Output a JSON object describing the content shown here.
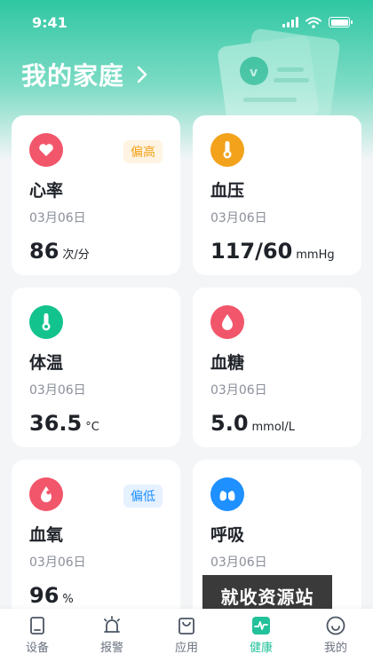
{
  "status_bar": {
    "time": "9:41"
  },
  "header": {
    "title": "我的家庭"
  },
  "colors": {
    "accent": "#23c19a",
    "red": "#f2566b",
    "orange": "#f3a21b",
    "green": "#13c38e",
    "blue": "#1e90ff"
  },
  "cards": [
    {
      "name": "心率",
      "date": "03月06日",
      "value": "86",
      "unit": "次/分",
      "badge": "偏高",
      "icon": "heart-icon",
      "icon_color": "#f2566b"
    },
    {
      "name": "血压",
      "date": "03月06日",
      "value": "117/60",
      "unit": "mmHg",
      "badge": "",
      "icon": "thermometer-icon",
      "icon_color": "#f3a21b"
    },
    {
      "name": "体温",
      "date": "03月06日",
      "value": "36.5",
      "unit": "°C",
      "badge": "",
      "icon": "thermometer-icon",
      "icon_color": "#13c38e"
    },
    {
      "name": "血糖",
      "date": "03月06日",
      "value": "5.0",
      "unit": "mmol/L",
      "badge": "",
      "icon": "drop-icon",
      "icon_color": "#f2566b"
    },
    {
      "name": "血氧",
      "date": "03月06日",
      "value": "96",
      "unit": "%",
      "badge": "偏低",
      "icon": "drop-icon",
      "icon_color": "#f2566b"
    },
    {
      "name": "呼吸",
      "date": "03月06日",
      "value": "",
      "unit": "",
      "badge": "",
      "icon": "lungs-icon",
      "icon_color": "#1e90ff"
    }
  ],
  "watermark": "就收资源站",
  "tabs": [
    {
      "label": "设备",
      "icon": "device-icon",
      "active": false
    },
    {
      "label": "报警",
      "icon": "alarm-icon",
      "active": false
    },
    {
      "label": "应用",
      "icon": "bag-icon",
      "active": false
    },
    {
      "label": "健康",
      "icon": "pulse-icon",
      "active": true
    },
    {
      "label": "我的",
      "icon": "smile-icon",
      "active": false
    }
  ]
}
